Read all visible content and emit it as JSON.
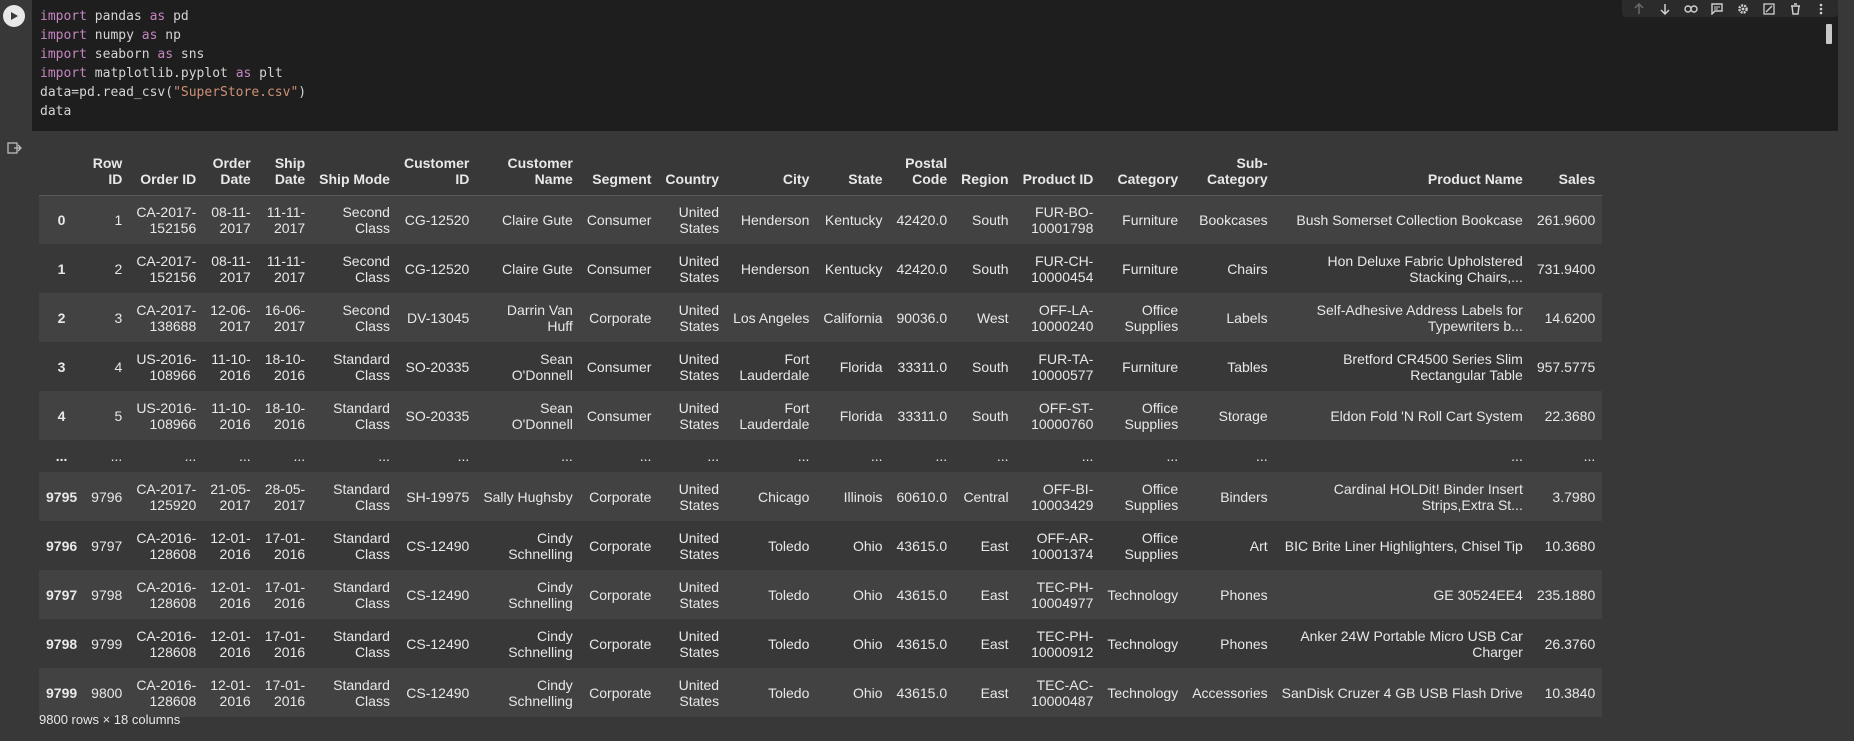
{
  "code_lines": [
    {
      "kw": "import",
      "rest": " pandas ",
      "kw2": "as",
      "rest2": " pd"
    },
    {
      "kw": "import",
      "rest": " numpy ",
      "kw2": "as",
      "rest2": " np"
    },
    {
      "kw": "import",
      "rest": " seaborn ",
      "kw2": "as",
      "rest2": " sns"
    },
    {
      "kw": "import",
      "rest": " matplotlib.pyplot ",
      "kw2": "as",
      "rest2": " plt"
    }
  ],
  "code_read_prefix": "data=pd.read_csv(",
  "code_read_arg": "\"SuperStore.csv\"",
  "code_read_suffix": ")",
  "code_last": "data",
  "table": {
    "columns": [
      "",
      "Row\nID",
      "Order ID",
      "Order\nDate",
      "Ship\nDate",
      "Ship Mode",
      "Customer\nID",
      "Customer\nName",
      "Segment",
      "Country",
      "City",
      "State",
      "Postal\nCode",
      "Region",
      "Product ID",
      "Category",
      "Sub-\nCategory",
      "Product Name",
      "Sales"
    ],
    "rows": [
      [
        "0",
        "1",
        "CA-2017-\n152156",
        "08-11-\n2017",
        "11-11-\n2017",
        "Second\nClass",
        "CG-12520",
        "Claire Gute",
        "Consumer",
        "United\nStates",
        "Henderson",
        "Kentucky",
        "42420.0",
        "South",
        "FUR-BO-\n10001798",
        "Furniture",
        "Bookcases",
        "Bush Somerset Collection Bookcase",
        "261.9600"
      ],
      [
        "1",
        "2",
        "CA-2017-\n152156",
        "08-11-\n2017",
        "11-11-\n2017",
        "Second\nClass",
        "CG-12520",
        "Claire Gute",
        "Consumer",
        "United\nStates",
        "Henderson",
        "Kentucky",
        "42420.0",
        "South",
        "FUR-CH-\n10000454",
        "Furniture",
        "Chairs",
        "Hon Deluxe Fabric Upholstered\nStacking Chairs,...",
        "731.9400"
      ],
      [
        "2",
        "3",
        "CA-2017-\n138688",
        "12-06-\n2017",
        "16-06-\n2017",
        "Second\nClass",
        "DV-13045",
        "Darrin Van\nHuff",
        "Corporate",
        "United\nStates",
        "Los Angeles",
        "California",
        "90036.0",
        "West",
        "OFF-LA-\n10000240",
        "Office\nSupplies",
        "Labels",
        "Self-Adhesive Address Labels for\nTypewriters b...",
        "14.6200"
      ],
      [
        "3",
        "4",
        "US-2016-\n108966",
        "11-10-\n2016",
        "18-10-\n2016",
        "Standard\nClass",
        "SO-20335",
        "Sean\nO'Donnell",
        "Consumer",
        "United\nStates",
        "Fort\nLauderdale",
        "Florida",
        "33311.0",
        "South",
        "FUR-TA-\n10000577",
        "Furniture",
        "Tables",
        "Bretford CR4500 Series Slim\nRectangular Table",
        "957.5775"
      ],
      [
        "4",
        "5",
        "US-2016-\n108966",
        "11-10-\n2016",
        "18-10-\n2016",
        "Standard\nClass",
        "SO-20335",
        "Sean\nO'Donnell",
        "Consumer",
        "United\nStates",
        "Fort\nLauderdale",
        "Florida",
        "33311.0",
        "South",
        "OFF-ST-\n10000760",
        "Office\nSupplies",
        "Storage",
        "Eldon Fold 'N Roll Cart System",
        "22.3680"
      ],
      [
        "...",
        "...",
        "...",
        "...",
        "...",
        "...",
        "...",
        "...",
        "...",
        "...",
        "...",
        "...",
        "...",
        "...",
        "...",
        "...",
        "...",
        "...",
        "..."
      ],
      [
        "9795",
        "9796",
        "CA-2017-\n125920",
        "21-05-\n2017",
        "28-05-\n2017",
        "Standard\nClass",
        "SH-19975",
        "Sally Hughsby",
        "Corporate",
        "United\nStates",
        "Chicago",
        "Illinois",
        "60610.0",
        "Central",
        "OFF-BI-\n10003429",
        "Office\nSupplies",
        "Binders",
        "Cardinal HOLDit! Binder Insert\nStrips,Extra St...",
        "3.7980"
      ],
      [
        "9796",
        "9797",
        "CA-2016-\n128608",
        "12-01-\n2016",
        "17-01-\n2016",
        "Standard\nClass",
        "CS-12490",
        "Cindy\nSchnelling",
        "Corporate",
        "United\nStates",
        "Toledo",
        "Ohio",
        "43615.0",
        "East",
        "OFF-AR-\n10001374",
        "Office\nSupplies",
        "Art",
        "BIC Brite Liner Highlighters, Chisel Tip",
        "10.3680"
      ],
      [
        "9797",
        "9798",
        "CA-2016-\n128608",
        "12-01-\n2016",
        "17-01-\n2016",
        "Standard\nClass",
        "CS-12490",
        "Cindy\nSchnelling",
        "Corporate",
        "United\nStates",
        "Toledo",
        "Ohio",
        "43615.0",
        "East",
        "TEC-PH-\n10004977",
        "Technology",
        "Phones",
        "GE 30524EE4",
        "235.1880"
      ],
      [
        "9798",
        "9799",
        "CA-2016-\n128608",
        "12-01-\n2016",
        "17-01-\n2016",
        "Standard\nClass",
        "CS-12490",
        "Cindy\nSchnelling",
        "Corporate",
        "United\nStates",
        "Toledo",
        "Ohio",
        "43615.0",
        "East",
        "TEC-PH-\n10000912",
        "Technology",
        "Phones",
        "Anker 24W Portable Micro USB Car\nCharger",
        "26.3760"
      ],
      [
        "9799",
        "9800",
        "CA-2016-\n128608",
        "12-01-\n2016",
        "17-01-\n2016",
        "Standard\nClass",
        "CS-12490",
        "Cindy\nSchnelling",
        "Corporate",
        "United\nStates",
        "Toledo",
        "Ohio",
        "43615.0",
        "East",
        "TEC-AC-\n10000487",
        "Technology",
        "Accessories",
        "SanDisk Cruzer 4 GB USB Flash Drive",
        "10.3840"
      ]
    ]
  },
  "summary": "9800 rows × 18 columns",
  "toolbar_icons": [
    "arrow-up-icon",
    "arrow-down-icon",
    "link-icon",
    "comment-icon",
    "gear-icon",
    "mirror-cell-icon",
    "trash-icon",
    "more-vert-icon"
  ],
  "colors": {
    "keyword": "#c586c0",
    "string": "#ce9178",
    "editor_bg": "#1e1e1e",
    "output_bg": "#383838"
  }
}
